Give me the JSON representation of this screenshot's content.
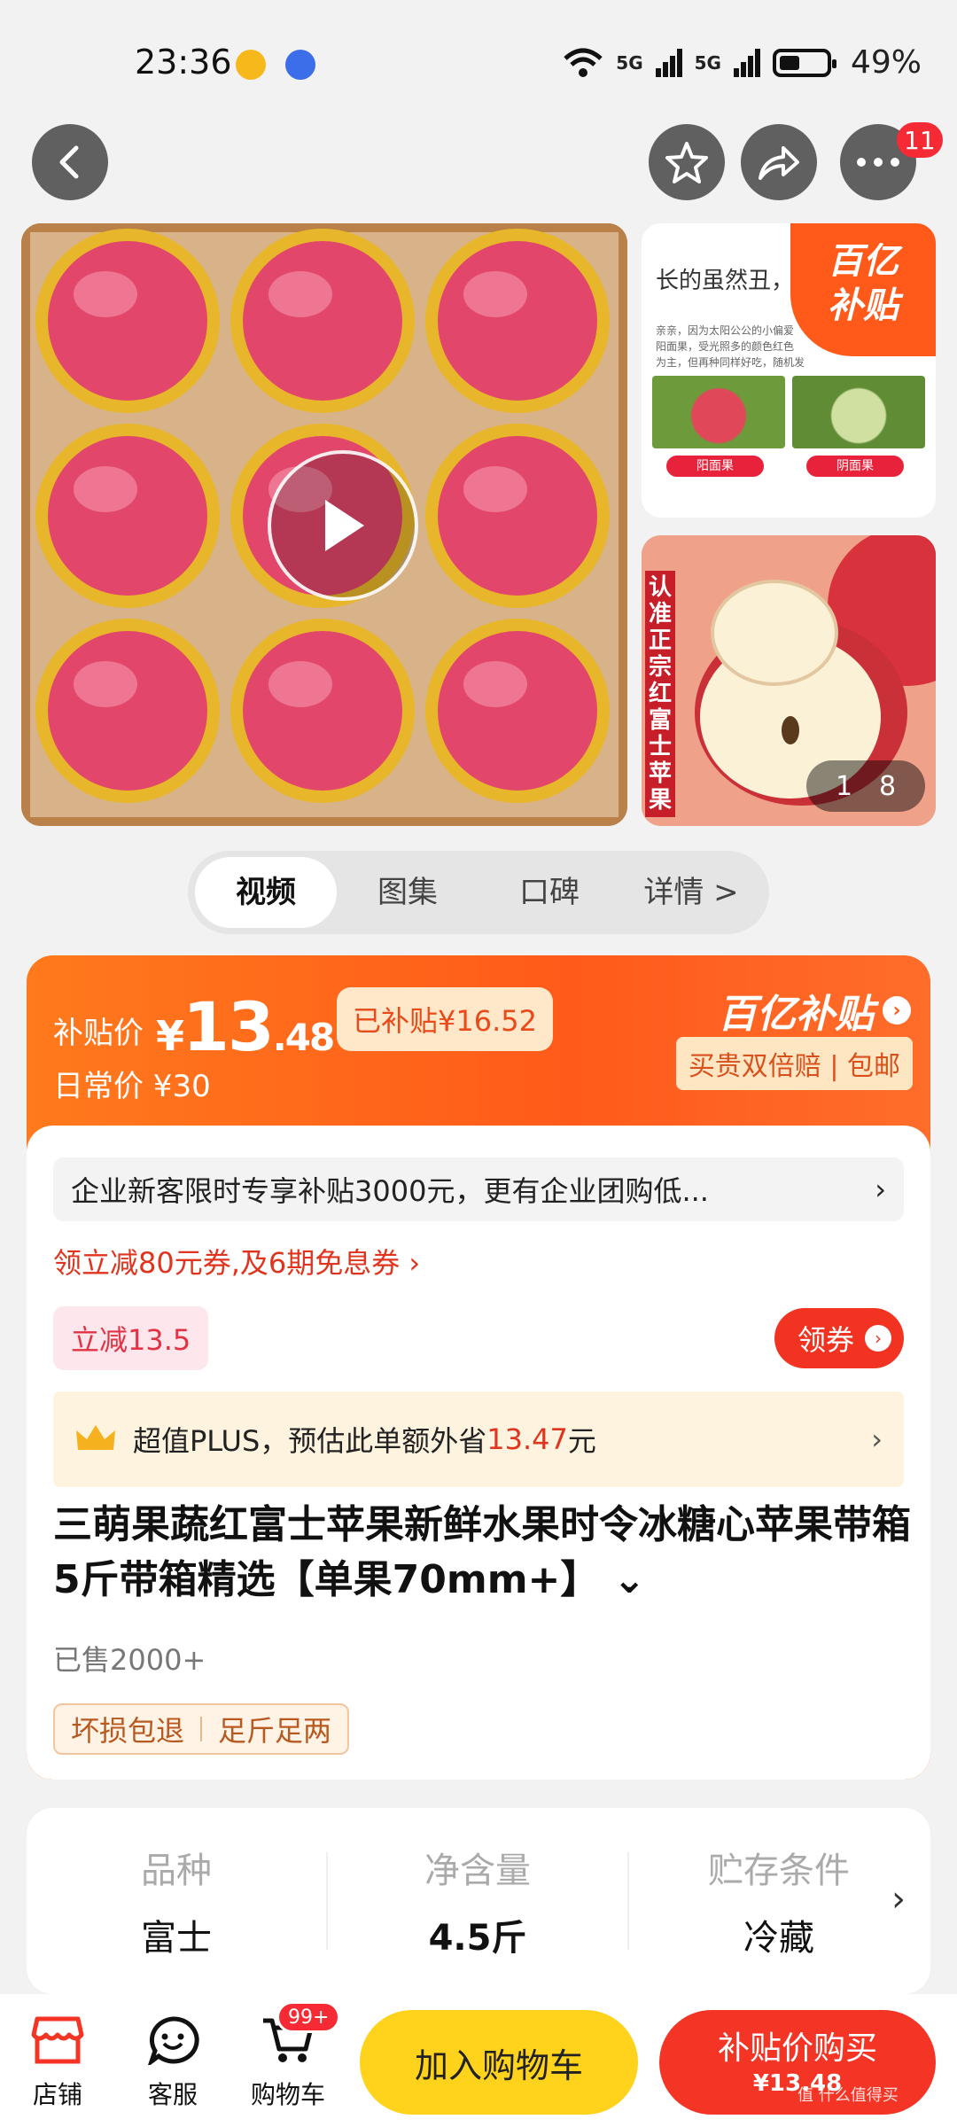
{
  "status_bar": {
    "time": "23:36",
    "battery": "49%",
    "signal_1": "5G",
    "signal_2": "5G"
  },
  "header": {
    "notification_count": "11"
  },
  "media": {
    "side1_heading": "长的虽然丑，",
    "side1_badge_top": "百亿",
    "side1_badge_bottom": "补贴",
    "side1_small_text_1": "亲亲，因为太阳公公的小偏爱",
    "side1_small_text_2": "阳面果，受光照多的颜色红色",
    "side1_small_text_3": "为主，但再种同样好吃，随机发",
    "side1_tag_left": "阳面果",
    "side1_tag_right": "阴面果",
    "side2_vertical_text": "认准正宗红富士苹果",
    "counter_current": "1",
    "counter_total": "8"
  },
  "tabs": [
    "视频",
    "图集",
    "口碑",
    "详情 >"
  ],
  "price": {
    "label": "补贴价",
    "currency": "¥",
    "integer": "13",
    "decimal": ".48",
    "subsidized": "已补贴¥16.52",
    "regular": "日常价 ¥30",
    "brand": "百亿补贴",
    "promise": "买贵双倍赔 | 包邮"
  },
  "offers": {
    "notice": "企业新客限时专享补贴3000元，更有企业团购低...",
    "coupon_link": "领立减80元券,及6期免息券 ›",
    "reduce": "立减13.5",
    "get_coupon": "领券",
    "plus_prefix": "超值PLUS，预估此单额外省",
    "plus_amount": "13.47",
    "plus_suffix": "元"
  },
  "product": {
    "title": "三萌果蔬红富士苹果新鲜水果时令冰糖心苹果带箱 5斤带箱精选【单果70mm+】 ⌄",
    "sold": "已售2000+",
    "guarantee_1": "坏损包退",
    "guarantee_2": "足斤足两"
  },
  "specs": [
    {
      "k": "品种",
      "v": "富士"
    },
    {
      "k": "净含量",
      "v": "4.5斤"
    },
    {
      "k": "贮存条件",
      "v": "冷藏"
    }
  ],
  "bottom": {
    "shop": "店铺",
    "service": "客服",
    "cart": "购物车",
    "cart_badge": "99+",
    "add_cart": "加入购物车",
    "buy_title": "补贴价购买",
    "buy_price": "¥13.48"
  },
  "watermark": "值 什么值得买",
  "colors": {
    "accent": "#ff5a1a",
    "red": "#f43424",
    "yellow": "#ffd21c"
  }
}
